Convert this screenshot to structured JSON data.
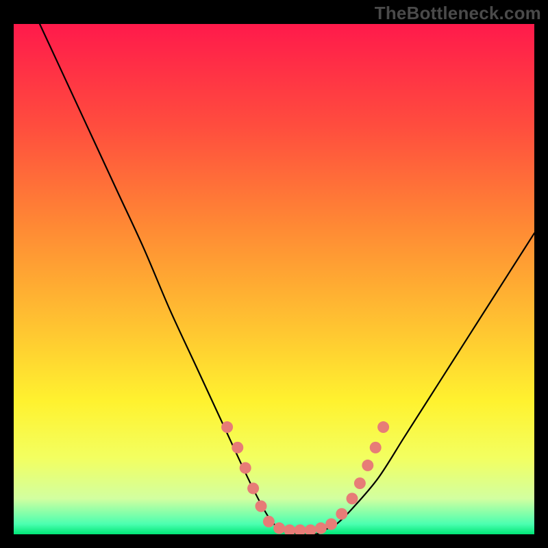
{
  "watermark": "TheBottleneck.com",
  "chart_data": {
    "type": "line",
    "title": "",
    "xlabel": "",
    "ylabel": "",
    "xlim": [
      0,
      100
    ],
    "ylim": [
      0,
      100
    ],
    "grid": false,
    "legend": false,
    "series": [
      {
        "name": "bottleneck-curve",
        "x": [
          5,
          10,
          15,
          20,
          25,
          30,
          35,
          40,
          45,
          48,
          50,
          52,
          55,
          58,
          60,
          62,
          65,
          70,
          75,
          80,
          85,
          90,
          95,
          100
        ],
        "y": [
          100,
          89,
          78,
          67,
          56,
          44,
          33,
          22,
          11,
          5,
          2,
          1,
          0,
          0,
          1,
          2,
          5,
          11,
          19,
          27,
          35,
          43,
          51,
          59
        ]
      }
    ],
    "markers": {
      "name": "highlight-dots",
      "color": "#e77c77",
      "points": [
        {
          "x": 41,
          "y": 21
        },
        {
          "x": 43,
          "y": 17
        },
        {
          "x": 44.5,
          "y": 13
        },
        {
          "x": 46,
          "y": 9
        },
        {
          "x": 47.5,
          "y": 5.5
        },
        {
          "x": 49,
          "y": 2.5
        },
        {
          "x": 51,
          "y": 1.2
        },
        {
          "x": 53,
          "y": 0.8
        },
        {
          "x": 55,
          "y": 0.8
        },
        {
          "x": 57,
          "y": 0.8
        },
        {
          "x": 59,
          "y": 1.2
        },
        {
          "x": 61,
          "y": 2
        },
        {
          "x": 63,
          "y": 4
        },
        {
          "x": 65,
          "y": 7
        },
        {
          "x": 66.5,
          "y": 10
        },
        {
          "x": 68,
          "y": 13.5
        },
        {
          "x": 69.5,
          "y": 17
        },
        {
          "x": 71,
          "y": 21
        }
      ]
    },
    "background_gradient": {
      "stops": [
        {
          "offset": 0.0,
          "color": "#ff1a4b"
        },
        {
          "offset": 0.2,
          "color": "#ff4d3e"
        },
        {
          "offset": 0.4,
          "color": "#ff8a34"
        },
        {
          "offset": 0.6,
          "color": "#ffc631"
        },
        {
          "offset": 0.74,
          "color": "#fff22f"
        },
        {
          "offset": 0.85,
          "color": "#f3ff60"
        },
        {
          "offset": 0.93,
          "color": "#d2ffa0"
        },
        {
          "offset": 0.98,
          "color": "#4bffb0"
        },
        {
          "offset": 1.0,
          "color": "#00e676"
        }
      ]
    }
  }
}
